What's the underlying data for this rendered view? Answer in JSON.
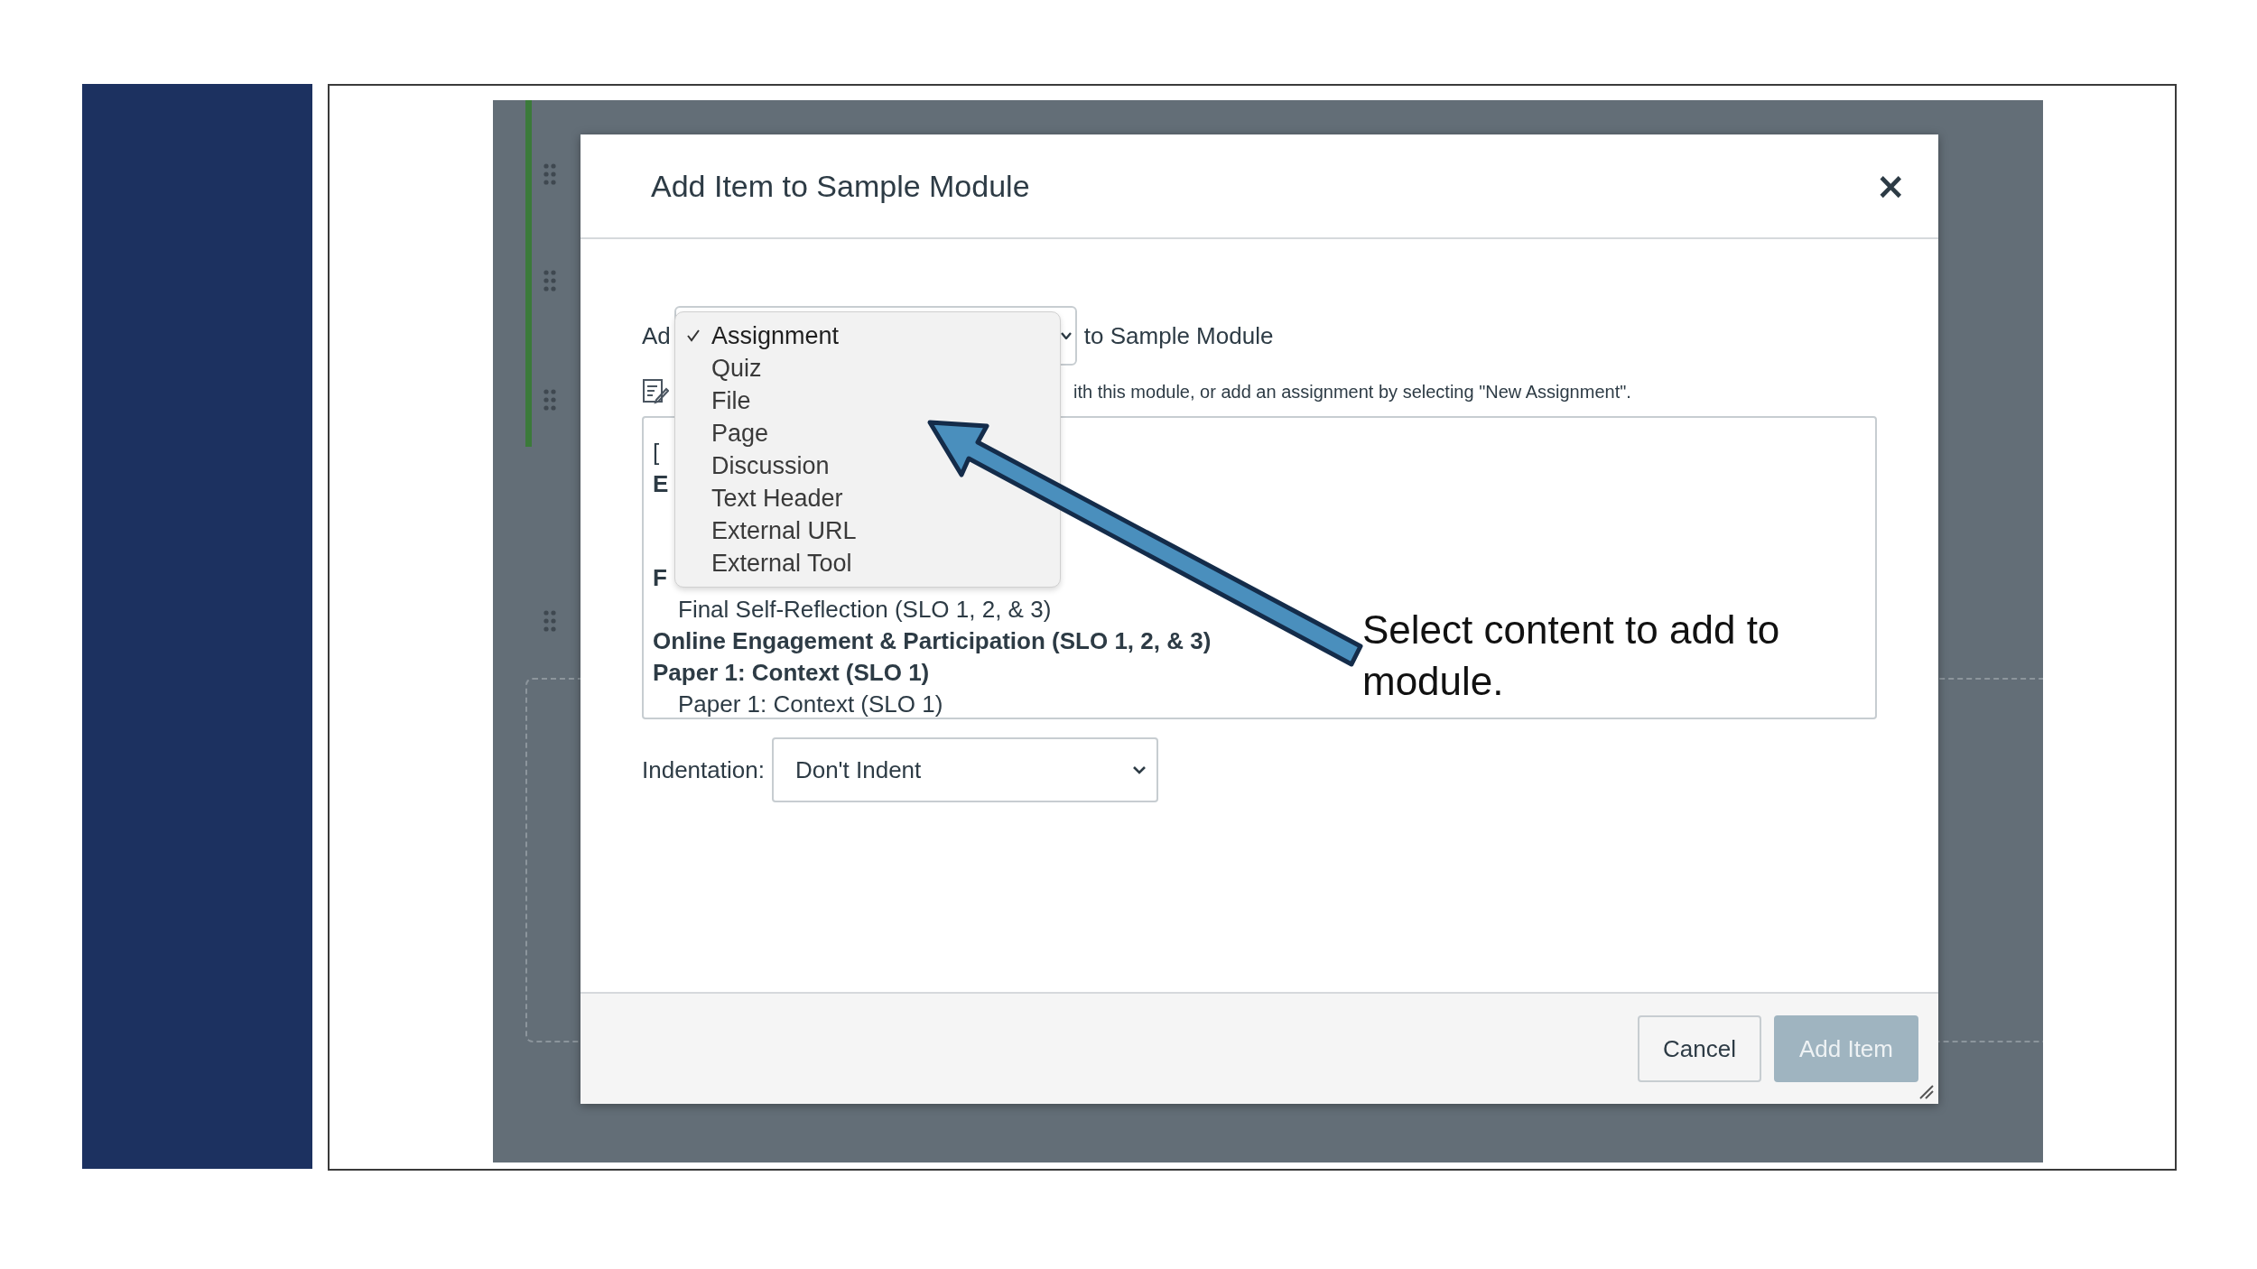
{
  "slide": {
    "caption": "Select content to add to module."
  },
  "dialog": {
    "title": "Add Item to Sample Module",
    "close": "×",
    "add_label": "Ad",
    "target": "to Sample Module",
    "hint": "ith this module, or add an assignment by selecting \"New Assignment\".",
    "type_menu": [
      {
        "label": "Assignment",
        "selected": true
      },
      {
        "label": "Quiz",
        "selected": false
      },
      {
        "label": "File",
        "selected": false
      },
      {
        "label": "Page",
        "selected": false
      },
      {
        "label": "Discussion",
        "selected": false
      },
      {
        "label": "Text Header",
        "selected": false
      },
      {
        "label": "External URL",
        "selected": false
      },
      {
        "label": "External Tool",
        "selected": false
      }
    ],
    "list_rows": [
      {
        "text": "[",
        "kind": "stub"
      },
      {
        "text": "E",
        "kind": "group"
      },
      {
        "text": "F",
        "kind": "group"
      },
      {
        "text": "Final Self-Reflection (SLO 1, 2, & 3)",
        "kind": "item"
      },
      {
        "text": "Online Engagement & Participation (SLO 1, 2, & 3)",
        "kind": "group"
      },
      {
        "text": "Paper 1: Context (SLO 1)",
        "kind": "group"
      },
      {
        "text": "Paper 1: Context (SLO 1)",
        "kind": "item"
      }
    ],
    "indentation": {
      "label": "Indentation:",
      "value": "Don't Indent"
    },
    "buttons": [
      {
        "label": "Cancel",
        "kind": "secondary",
        "disabled": false
      },
      {
        "label": "Add Item",
        "kind": "primary",
        "disabled": true
      }
    ]
  }
}
